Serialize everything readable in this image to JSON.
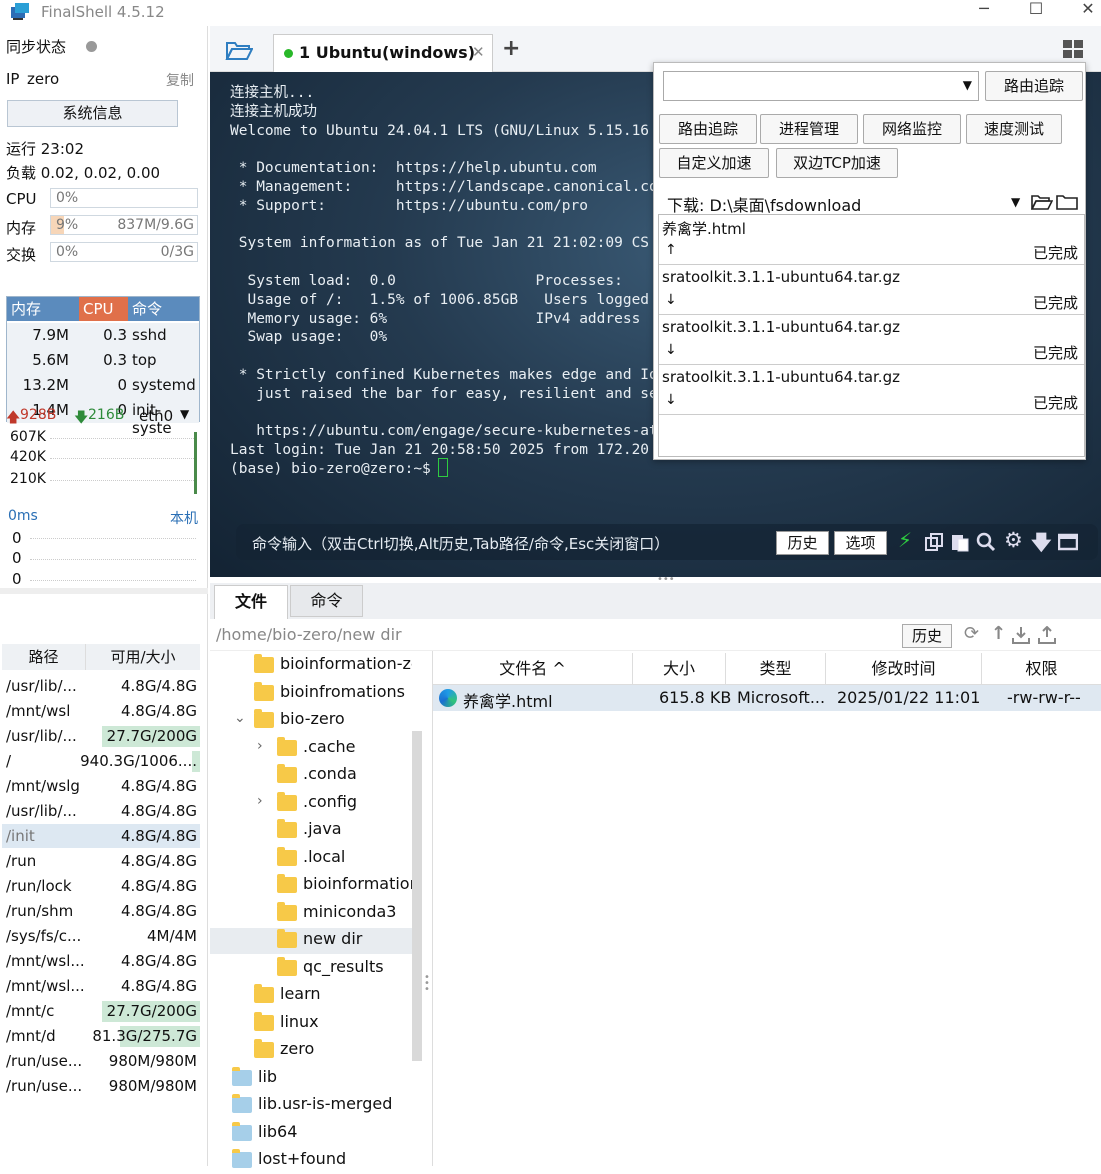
{
  "window": {
    "title": "FinalShell 4.5.12",
    "minimize": "─",
    "maximize": "☐",
    "close": "✕"
  },
  "left": {
    "sync_label": "同步状态",
    "ip_label": "IP",
    "ip_value": "zero",
    "copy_label": "复制",
    "sysinfo_btn": "系统信息",
    "uptime": "运行 23:02",
    "load": "负载 0.02, 0.02, 0.00",
    "cpu_label": "CPU",
    "cpu_value": "0%",
    "cpu_fraction": 0,
    "mem_label": "内存",
    "mem_pct": "9%",
    "mem_value": "837M/9.6G",
    "mem_fraction": 0.09,
    "swap_label": "交换",
    "swap_pct": "0%",
    "swap_value": "0/3G",
    "swap_fraction": 0,
    "proc_headers": [
      "内存",
      "CPU",
      "命令"
    ],
    "processes": [
      {
        "mem": "7.9M",
        "cpu": "0.3",
        "cmd": "sshd"
      },
      {
        "mem": "5.6M",
        "cpu": "0.3",
        "cmd": "top"
      },
      {
        "mem": "13.2M",
        "cpu": "0",
        "cmd": "systemd"
      },
      {
        "mem": "1.4M",
        "cpu": "0",
        "cmd": "init-syste"
      }
    ],
    "net_up": "928B",
    "net_down": "216B",
    "net_iface": "eth0",
    "net_ticks": [
      "607K",
      "420K",
      "210K"
    ],
    "ping_label": "0ms",
    "ping_host": "本机",
    "ping_ticks": [
      "0",
      "0",
      "0"
    ],
    "disk_headers": [
      "路径",
      "可用/大小"
    ],
    "disks": [
      {
        "path": "/usr/lib/...",
        "size": "4.8G/4.8G",
        "used": 0
      },
      {
        "path": "/mnt/wsl",
        "size": "4.8G/4.8G",
        "used": 0
      },
      {
        "path": "/usr/lib/...",
        "size": "27.7G/200G",
        "used": 0.86
      },
      {
        "path": "/",
        "size": "940.3G/1006....",
        "used": 0.07
      },
      {
        "path": "/mnt/wslg",
        "size": "4.8G/4.8G",
        "used": 0
      },
      {
        "path": "/usr/lib/...",
        "size": "4.8G/4.8G",
        "used": 0
      },
      {
        "path": "/init",
        "size": "4.8G/4.8G",
        "used": 0
      },
      {
        "path": "/run",
        "size": "4.8G/4.8G",
        "used": 0
      },
      {
        "path": "/run/lock",
        "size": "4.8G/4.8G",
        "used": 0
      },
      {
        "path": "/run/shm",
        "size": "4.8G/4.8G",
        "used": 0
      },
      {
        "path": "/sys/fs/c...",
        "size": "4M/4M",
        "used": 0
      },
      {
        "path": "/mnt/wsl...",
        "size": "4.8G/4.8G",
        "used": 0
      },
      {
        "path": "/mnt/wsl...",
        "size": "4.8G/4.8G",
        "used": 0
      },
      {
        "path": "/mnt/c",
        "size": "27.7G/200G",
        "used": 0.86
      },
      {
        "path": "/mnt/d",
        "size": "81.3G/275.7G",
        "used": 0.7
      },
      {
        "path": "/run/use...",
        "size": "980M/980M",
        "used": 0
      },
      {
        "path": "/run/use...",
        "size": "980M/980M",
        "used": 0
      }
    ]
  },
  "tabs": {
    "active_label": "1 Ubuntu(windows)",
    "add": "+"
  },
  "terminal": {
    "lines": [
      "连接主机...",
      "连接主机成功",
      "Welcome to Ubuntu 24.04.1 LTS (GNU/Linux 5.15.16",
      "",
      " * Documentation:  https://help.ubuntu.com",
      " * Management:     https://landscape.canonical.co",
      " * Support:        https://ubuntu.com/pro",
      "",
      " System information as of Tue Jan 21 21:02:09 CS",
      "",
      "  System load:  0.0                Processes:",
      "  Usage of /:   1.5% of 1006.85GB   Users logged",
      "  Memory usage: 6%                 IPv4 address",
      "  Swap usage:   0%",
      "",
      " * Strictly confined Kubernetes makes edge and Io",
      "   just raised the bar for easy, resilient and se",
      "",
      "   https://ubuntu.com/engage/secure-kubernetes-at",
      "Last login: Tue Jan 21 20:58:50 2025 from 172.20",
      "(base) bio-zero@zero:~$ "
    ],
    "cmd_hint": "命令输入（双击Ctrl切换,Alt历史,Tab路径/命令,Esc关闭窗口）",
    "history_btn": "历史",
    "options_btn": "选项"
  },
  "popup": {
    "select_value": "",
    "route_btn": "路由追踪",
    "tools": [
      "路由追踪",
      "进程管理",
      "网络监控",
      "速度测试",
      "自定义加速",
      "双边TCP加速"
    ],
    "download_label": "下载: D:\\桌面\\fsdownload",
    "downloads": [
      {
        "name": "养禽学.html",
        "arrow": "↑",
        "status": "已完成"
      },
      {
        "name": "sratoolkit.3.1.1-ubuntu64.tar.gz",
        "arrow": "↓",
        "status": "已完成"
      },
      {
        "name": "sratoolkit.3.1.1-ubuntu64.tar.gz",
        "arrow": "↓",
        "status": "已完成"
      },
      {
        "name": "sratoolkit.3.1.1-ubuntu64.tar.gz",
        "arrow": "↓",
        "status": "已完成"
      }
    ]
  },
  "bottom": {
    "tabs": [
      "文件",
      "命令"
    ],
    "path": "/home/bio-zero/new dir",
    "history_btn": "历史",
    "tree": [
      {
        "label": "bioinformation-ze",
        "depth": 1,
        "exp": ""
      },
      {
        "label": "bioinfromations",
        "depth": 1,
        "exp": ""
      },
      {
        "label": "bio-zero",
        "depth": 1,
        "exp": "⌄"
      },
      {
        "label": ".cache",
        "depth": 2,
        "exp": "›"
      },
      {
        "label": ".conda",
        "depth": 2,
        "exp": ""
      },
      {
        "label": ".config",
        "depth": 2,
        "exp": "›"
      },
      {
        "label": ".java",
        "depth": 2,
        "exp": ""
      },
      {
        "label": ".local",
        "depth": 2,
        "exp": ""
      },
      {
        "label": "bioinformation",
        "depth": 2,
        "exp": ""
      },
      {
        "label": "miniconda3",
        "depth": 2,
        "exp": ""
      },
      {
        "label": "new dir",
        "depth": 2,
        "exp": ""
      },
      {
        "label": "qc_results",
        "depth": 2,
        "exp": ""
      },
      {
        "label": "learn",
        "depth": 1,
        "exp": ""
      },
      {
        "label": "linux",
        "depth": 1,
        "exp": ""
      },
      {
        "label": "zero",
        "depth": 1,
        "exp": ""
      },
      {
        "label": "lib",
        "depth": 0,
        "exp": ""
      },
      {
        "label": "lib.usr-is-merged",
        "depth": 0,
        "exp": ""
      },
      {
        "label": "lib64",
        "depth": 0,
        "exp": ""
      },
      {
        "label": "lost+found",
        "depth": 0,
        "exp": ""
      }
    ],
    "file_headers": [
      "文件名 ^",
      "大小",
      "类型",
      "修改时间",
      "权限"
    ],
    "files": [
      {
        "name": "养禽学.html",
        "size": "615.8 KB",
        "type": "Microsoft...",
        "mtime": "2025/01/22 11:01",
        "perm": "-rw-rw-r--"
      }
    ]
  }
}
